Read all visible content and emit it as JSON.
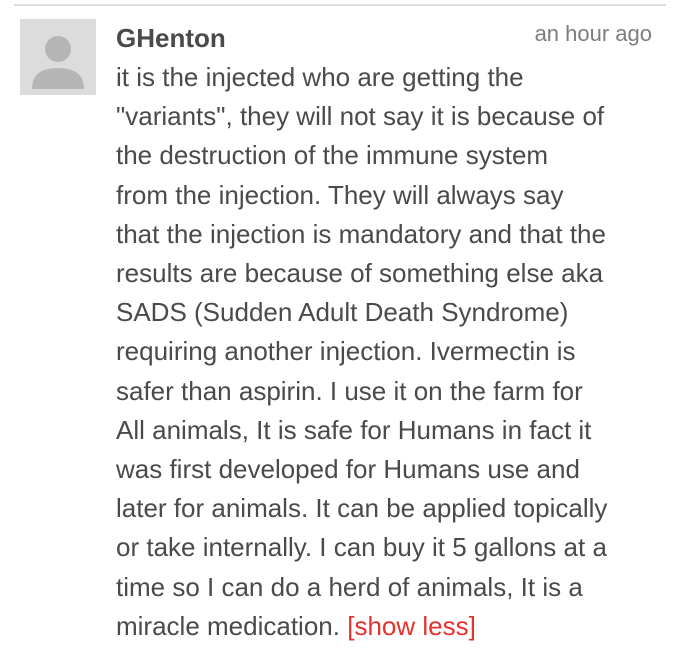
{
  "comment": {
    "author": "GHenton",
    "timestamp": "an hour ago",
    "avatar_icon": "default-user-icon",
    "body_lines": [
      "it is the injected who are getting the",
      "\"variants\", they will not say it is because of",
      "the destruction of the immune system",
      "from the injection. They will always say",
      "that the injection is mandatory and that the",
      "results are because of something else aka",
      "SADS (Sudden Adult Death Syndrome)",
      "requiring another injection. Ivermectin is",
      "safer than aspirin. I use it on the farm for",
      "All animals, It is safe for Humans in fact it",
      "was first developed for Humans use and",
      "later for animals. It can be applied topically",
      "or take internally. I can buy it 5 gallons at a",
      "time so I can do a herd of animals, It is a",
      "miracle medication."
    ],
    "toggle_label": "[show less]"
  },
  "colors": {
    "text": "#4a4a4a",
    "timestamp": "#7d7d7d",
    "link": "#e2332d",
    "avatar_bg": "#dcdcdc",
    "avatar_figure": "#b5b5b5",
    "divider": "#dedede"
  }
}
